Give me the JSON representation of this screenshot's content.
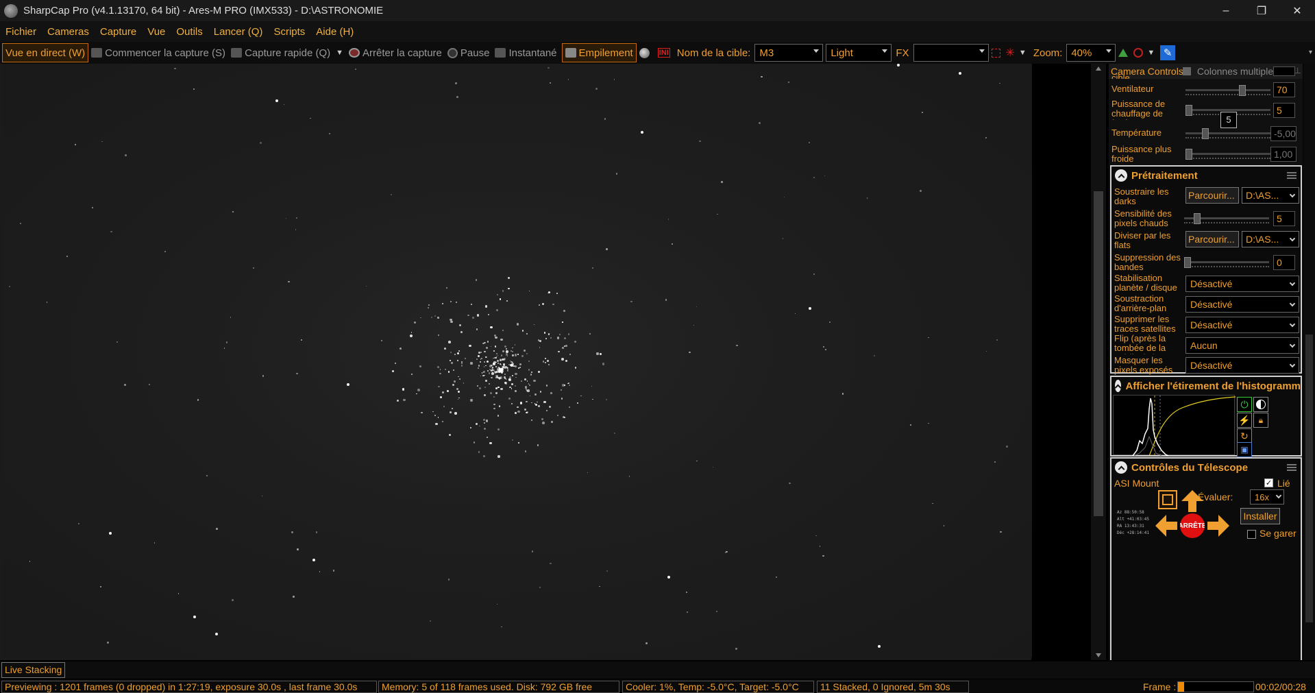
{
  "window": {
    "title": "SharpCap Pro (v4.1.13170, 64 bit) - Ares-M PRO (IMX533) - D:\\ASTRONOMIE",
    "minimize": "–",
    "restore": "❐",
    "close": "✕"
  },
  "menu": [
    "Fichier",
    "Cameras",
    "Capture",
    "Vue",
    "Outils",
    "Lancer (Q)",
    "Scripts",
    "Aide (H)"
  ],
  "toolbar": {
    "live_view": "Vue en direct (W)",
    "start_capture": "Commencer la capture (S)",
    "quick_capture": "Capture rapide (Q)",
    "stop_capture": "Arrêter la capture",
    "pause": "Pause",
    "snapshot": "Instantané",
    "stacking": "Empilement",
    "target_label": "Nom de la cible:",
    "target_value": "M3",
    "frame_type": "Light",
    "fx_label": "FX",
    "fx_value": "",
    "zoom_label": "Zoom:",
    "zoom_value": "40%"
  },
  "panel": {
    "tab_active": "Camera Controls",
    "tab_inactive": "Colonnes multiples",
    "camera_rows": [
      {
        "label": "Ventilateur",
        "value": "70"
      },
      {
        "label": "Puissance de chauffage de fenêtre",
        "value": "5",
        "tooltip": "5"
      },
      {
        "label": "Température",
        "value": "-5,00"
      },
      {
        "label": "Puissance plus froide",
        "value": "1,00"
      }
    ],
    "preprocessing": {
      "title": "Prétraitement",
      "darks_label": "Soustraire les darks",
      "darks_button": "Parcourir...",
      "darks_path": "D:\\AS...",
      "hotpix_label": "Sensibilité des pixels chauds",
      "hotpix_value": "5",
      "flats_label": "Diviser par les flats",
      "flats_button": "Parcourir...",
      "flats_path": "D:\\AS...",
      "banding_label": "Suppression des bandes",
      "banding_value": "0",
      "stabilisation_label": "Stabilisation planète / disque",
      "stabilisation_value": "Désactivé",
      "background_label": "Soustraction d'arrière-plan",
      "background_value": "Désactivé",
      "satellite_label": "Supprimer les traces satellites",
      "satellite_value": "Désactivé",
      "flip_label": "Flip (après la tombée de la nuit/à plat)",
      "flip_value": "Aucun",
      "mask_label": "Masquer les pixels exposés",
      "mask_value": "Désactivé"
    },
    "histogram": {
      "title": "Afficher l'étirement de l'histogramm"
    },
    "telescope": {
      "title": "Contrôles du Télescope",
      "mount": "ASI Mount",
      "linked_label": "Lié",
      "rate_label": "Évaluer:",
      "rate_value": "16x",
      "install_button": "Installer",
      "stop_button": "ARRÊTE",
      "park_label": "Se garer",
      "coords": [
        "Az    88:50:58",
        "Alt  +41:03:45",
        "RA    13:43:31",
        "Déc  +28:14:41"
      ]
    }
  },
  "bottom_tab": "Live Stacking",
  "status": {
    "preview": "Previewing : 1201 frames (0 dropped) in 1:27:19, exposure 30.0s , last frame 30.0s",
    "memory": "Memory: 5 of 118 frames used. Disk: 792 GB free",
    "cooler": "Cooler: 1%, Temp: -5.0°C, Target: -5.0°C",
    "stack": "11 Stacked, 0 Ignored, 5m 30s",
    "frame_label": "Frame :",
    "frame_progress": 0.08,
    "frame_time": "00:02/00:28"
  },
  "colors": {
    "accent": "#f0a030",
    "panel_border": "#d0d0d0",
    "stop_red": "#e01010"
  }
}
